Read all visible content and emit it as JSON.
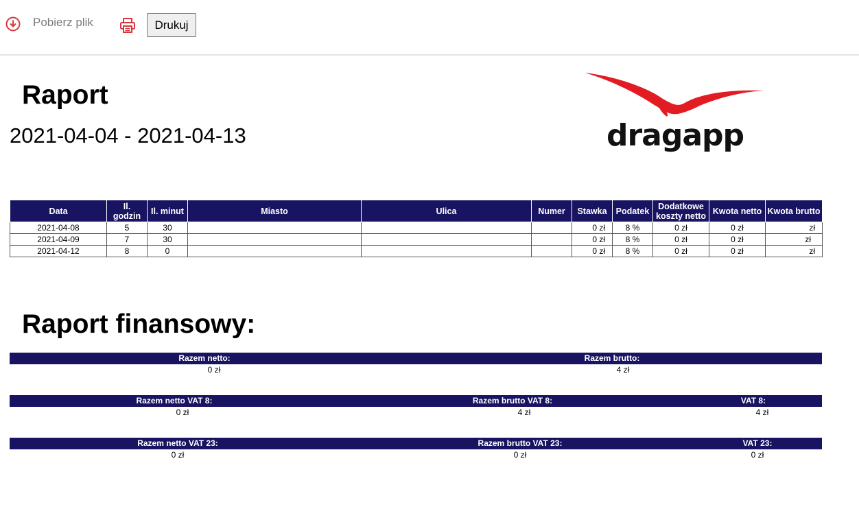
{
  "toolbar": {
    "download_label": "Pobierz plik",
    "print_label": "Drukuj",
    "icon_color": "#d9363e"
  },
  "header": {
    "title": "Raport",
    "date_range": "2021-04-04 - 2021-04-13",
    "logo_text": "dragapp",
    "logo_color": "#e31b23"
  },
  "table": {
    "columns": [
      "Data",
      "Il. godzin",
      "Il. minut",
      "Miasto",
      "Ulica",
      "Numer",
      "Stawka",
      "Podatek",
      "Dodatkowe koszty netto",
      "Kwota netto",
      "Kwota brutto"
    ],
    "rows": [
      [
        "2021-04-08",
        "5",
        "30",
        "",
        "",
        "",
        "0 zł",
        "8 %",
        "0 zł",
        "0 zł",
        "zł"
      ],
      [
        "2021-04-09",
        "7",
        "30",
        "",
        "",
        "",
        "0 zł",
        "8 %",
        "0 zł",
        "0 zł",
        "zł"
      ],
      [
        "2021-04-12",
        "8",
        "0",
        "",
        "",
        "",
        "0 zł",
        "8 %",
        "0 zł",
        "0 zł",
        "zł"
      ]
    ]
  },
  "finance": {
    "title": "Raport finansowy:",
    "block1": {
      "labels": [
        "Razem netto:",
        "Razem brutto:"
      ],
      "values": [
        "0 zł",
        "4 zł"
      ]
    },
    "block2": {
      "labels": [
        "Razem netto VAT 8:",
        "Razem brutto VAT 8:",
        "VAT 8:"
      ],
      "values": [
        "0 zł",
        "4 zł",
        "4 zł"
      ]
    },
    "block3": {
      "labels": [
        "Razem netto VAT 23:",
        "Razem brutto VAT 23:",
        "VAT 23:"
      ],
      "values": [
        "0 zł",
        "0 zł",
        "0 zł"
      ]
    }
  }
}
